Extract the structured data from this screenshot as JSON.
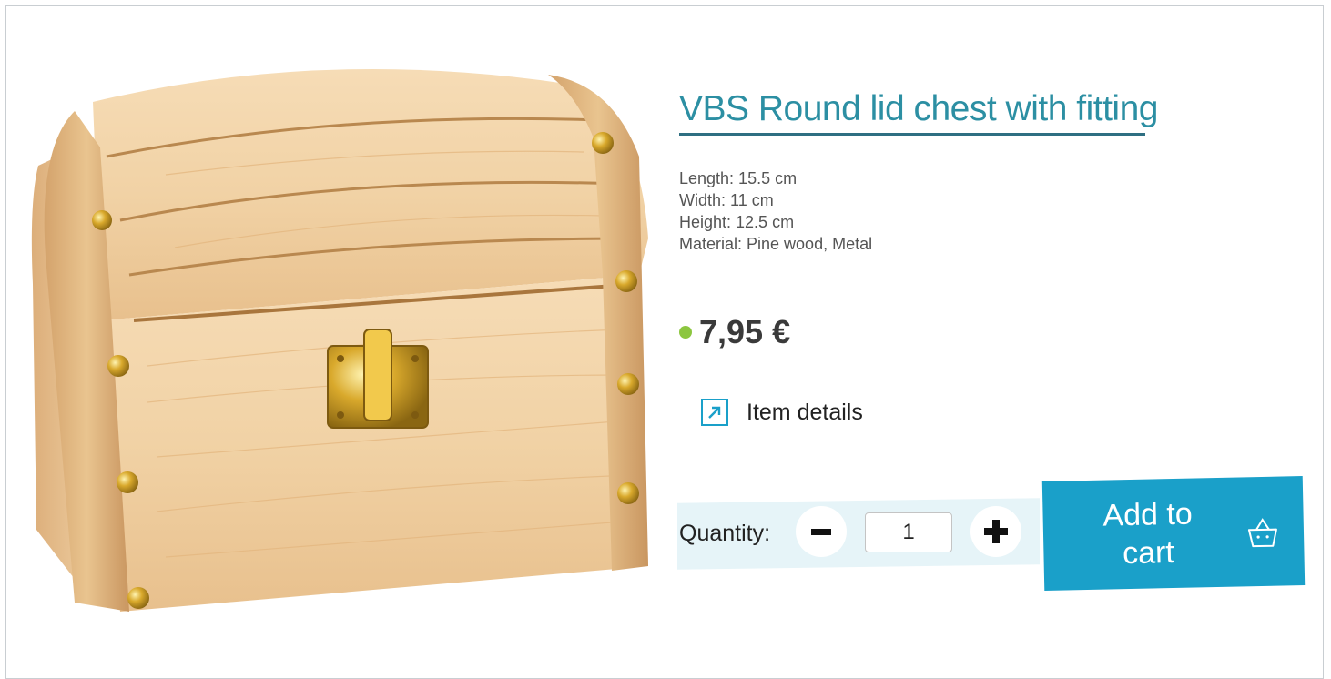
{
  "product": {
    "title": "VBS Round lid chest with fitting",
    "image_alt": "Wooden round lid chest with brass fittings",
    "specs": [
      "Length: 15.5 cm",
      "Width: 11 cm",
      "Height: 12.5 cm",
      "Material: Pine wood, Metal"
    ],
    "price": "7,95 €",
    "availability_color": "#8cc63f"
  },
  "links": {
    "item_details": "Item details",
    "item_details_icon": "external-arrow-icon"
  },
  "cart": {
    "quantity_label": "Quantity:",
    "quantity_value": "1",
    "minus_icon": "minus-icon",
    "plus_icon": "plus-icon",
    "add_to_cart_label": "Add to cart",
    "basket_icon": "shopping-basket-icon",
    "accent_color": "#1aa0c9"
  }
}
